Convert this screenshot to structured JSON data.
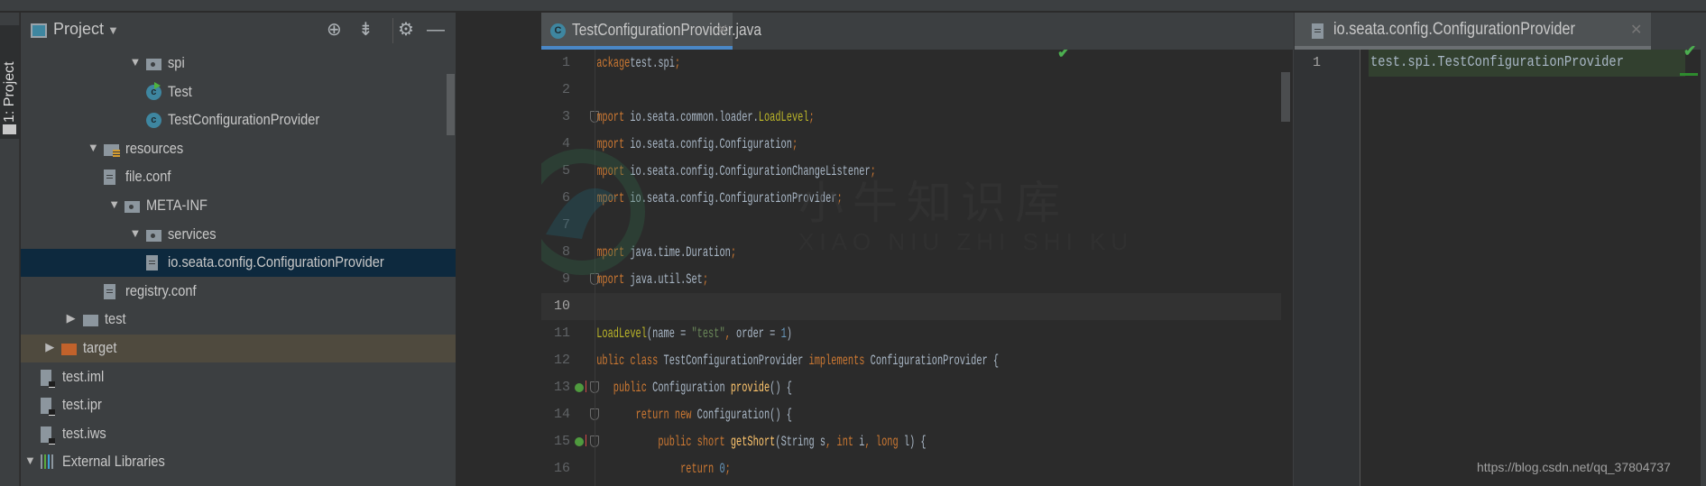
{
  "side_stripe": {
    "label": "1: Project"
  },
  "project_panel": {
    "title": "Project",
    "header_icons": [
      "locate-icon",
      "collapse-all-icon",
      "gear-icon",
      "minimize-icon"
    ],
    "tree": [
      {
        "label": "spi",
        "level": 5,
        "icon": "package-folder",
        "expanded": true
      },
      {
        "label": "Test",
        "level": 6,
        "icon": "class-runnable"
      },
      {
        "label": "TestConfigurationProvider",
        "level": 6,
        "icon": "class"
      },
      {
        "label": "resources",
        "level": 3,
        "icon": "resources-folder",
        "expanded": true
      },
      {
        "label": "file.conf",
        "level": 4,
        "icon": "file"
      },
      {
        "label": "META-INF",
        "level": 4,
        "icon": "package-folder",
        "expanded": true
      },
      {
        "label": "services",
        "level": 5,
        "icon": "package-folder",
        "expanded": true
      },
      {
        "label": "io.seata.config.ConfigurationProvider",
        "level": 6,
        "icon": "file",
        "selected": true
      },
      {
        "label": "registry.conf",
        "level": 4,
        "icon": "file"
      },
      {
        "label": "test",
        "level": 2,
        "icon": "folder",
        "expanded": false
      },
      {
        "label": "target",
        "level": 1,
        "icon": "excluded-folder",
        "expanded": false,
        "highlighted": true
      },
      {
        "label": "test.iml",
        "level": 1,
        "icon": "project-file"
      },
      {
        "label": "test.ipr",
        "level": 1,
        "icon": "project-file"
      },
      {
        "label": "test.iws",
        "level": 1,
        "icon": "project-file"
      },
      {
        "label": "External Libraries",
        "level": 0,
        "icon": "libraries",
        "expanded": true
      }
    ]
  },
  "editor": {
    "tab": {
      "label": "TestConfigurationProvider.java",
      "active": true
    },
    "current_line": 10,
    "status": "no-problems",
    "lines": [
      {
        "n": 1,
        "tokens": [
          [
            "kw",
            "package"
          ],
          [
            "",
            "test.spi"
          ],
          [
            "kw",
            ";"
          ]
        ]
      },
      {
        "n": 2,
        "tokens": []
      },
      {
        "n": 3,
        "fold": true,
        "tokens": [
          [
            "kw",
            "import"
          ],
          [
            "",
            " io.seata.common.loader."
          ],
          [
            "cls",
            "LoadLevel"
          ],
          [
            "kw",
            ";"
          ]
        ]
      },
      {
        "n": 4,
        "tokens": [
          [
            "kw",
            "import"
          ],
          [
            "",
            " io.seata.config.Configuration"
          ],
          [
            "kw",
            ";"
          ]
        ]
      },
      {
        "n": 5,
        "tokens": [
          [
            "kw",
            "import"
          ],
          [
            "",
            " io.seata.config.ConfigurationChangeListener"
          ],
          [
            "kw",
            ";"
          ]
        ]
      },
      {
        "n": 6,
        "tokens": [
          [
            "kw",
            "import"
          ],
          [
            "",
            " io.seata.config.ConfigurationProvider"
          ],
          [
            "kw",
            ";"
          ]
        ]
      },
      {
        "n": 7,
        "tokens": []
      },
      {
        "n": 8,
        "tokens": [
          [
            "kw",
            "import"
          ],
          [
            "",
            " java.time.Duration"
          ],
          [
            "kw",
            ";"
          ]
        ]
      },
      {
        "n": 9,
        "fold": true,
        "tokens": [
          [
            "kw",
            "import"
          ],
          [
            "",
            " java.util.Set"
          ],
          [
            "kw",
            ";"
          ]
        ]
      },
      {
        "n": 10,
        "tokens": []
      },
      {
        "n": 11,
        "tokens": [
          [
            "ann",
            "@LoadLevel"
          ],
          [
            "",
            "(name = "
          ],
          [
            "str",
            "\"test\""
          ],
          [
            "kw",
            ","
          ],
          [
            "",
            " order = "
          ],
          [
            "num",
            "1"
          ],
          [
            "",
            ")"
          ]
        ]
      },
      {
        "n": 12,
        "tokens": [
          [
            "kw",
            "public class"
          ],
          [
            "",
            " TestConfigurationProvider "
          ],
          [
            "kw",
            "implements"
          ],
          [
            "",
            " ConfigurationProvider {"
          ]
        ]
      },
      {
        "n": 13,
        "fold": true,
        "implements": true,
        "tokens": [
          [
            "",
            "    "
          ],
          [
            "kw",
            "public"
          ],
          [
            "",
            " Configuration "
          ],
          [
            "fn",
            "provide"
          ],
          [
            "",
            "() {"
          ]
        ]
      },
      {
        "n": 14,
        "fold": true,
        "tokens": [
          [
            "",
            "        "
          ],
          [
            "kw",
            "return new"
          ],
          [
            "",
            " Configuration() {"
          ]
        ]
      },
      {
        "n": 15,
        "fold": true,
        "implements": true,
        "tokens": [
          [
            "",
            "            "
          ],
          [
            "kw",
            "public short"
          ],
          [
            "",
            " "
          ],
          [
            "fn",
            "getShort"
          ],
          [
            "",
            "(String s"
          ],
          [
            "kw",
            ","
          ],
          [
            "",
            " "
          ],
          [
            "kw",
            "int"
          ],
          [
            "",
            " i"
          ],
          [
            "kw",
            ","
          ],
          [
            "",
            " "
          ],
          [
            "kw",
            "long"
          ],
          [
            "",
            " l) {"
          ]
        ]
      },
      {
        "n": 16,
        "tokens": [
          [
            "",
            "                "
          ],
          [
            "kw",
            "return"
          ],
          [
            "",
            " "
          ],
          [
            "num",
            "0"
          ],
          [
            "kw",
            ";"
          ]
        ]
      }
    ]
  },
  "right_editor": {
    "tab": {
      "label": "io.seata.config.ConfigurationProvider"
    },
    "lines": [
      {
        "n": 1,
        "text": "test.spi.TestConfigurationProvider"
      }
    ]
  },
  "watermark": {
    "cn": "小牛知识库",
    "pinyin": "XIAO NIU ZHI SHI KU"
  },
  "credit": "https://blog.csdn.net/qq_37804737",
  "colors": {
    "keyword": "#cc7832",
    "string": "#6a8759",
    "number": "#6897bb",
    "annotation": "#bbb529",
    "method": "#ffc66d",
    "accent": "#4a88c7",
    "selection": "#0d293e"
  }
}
